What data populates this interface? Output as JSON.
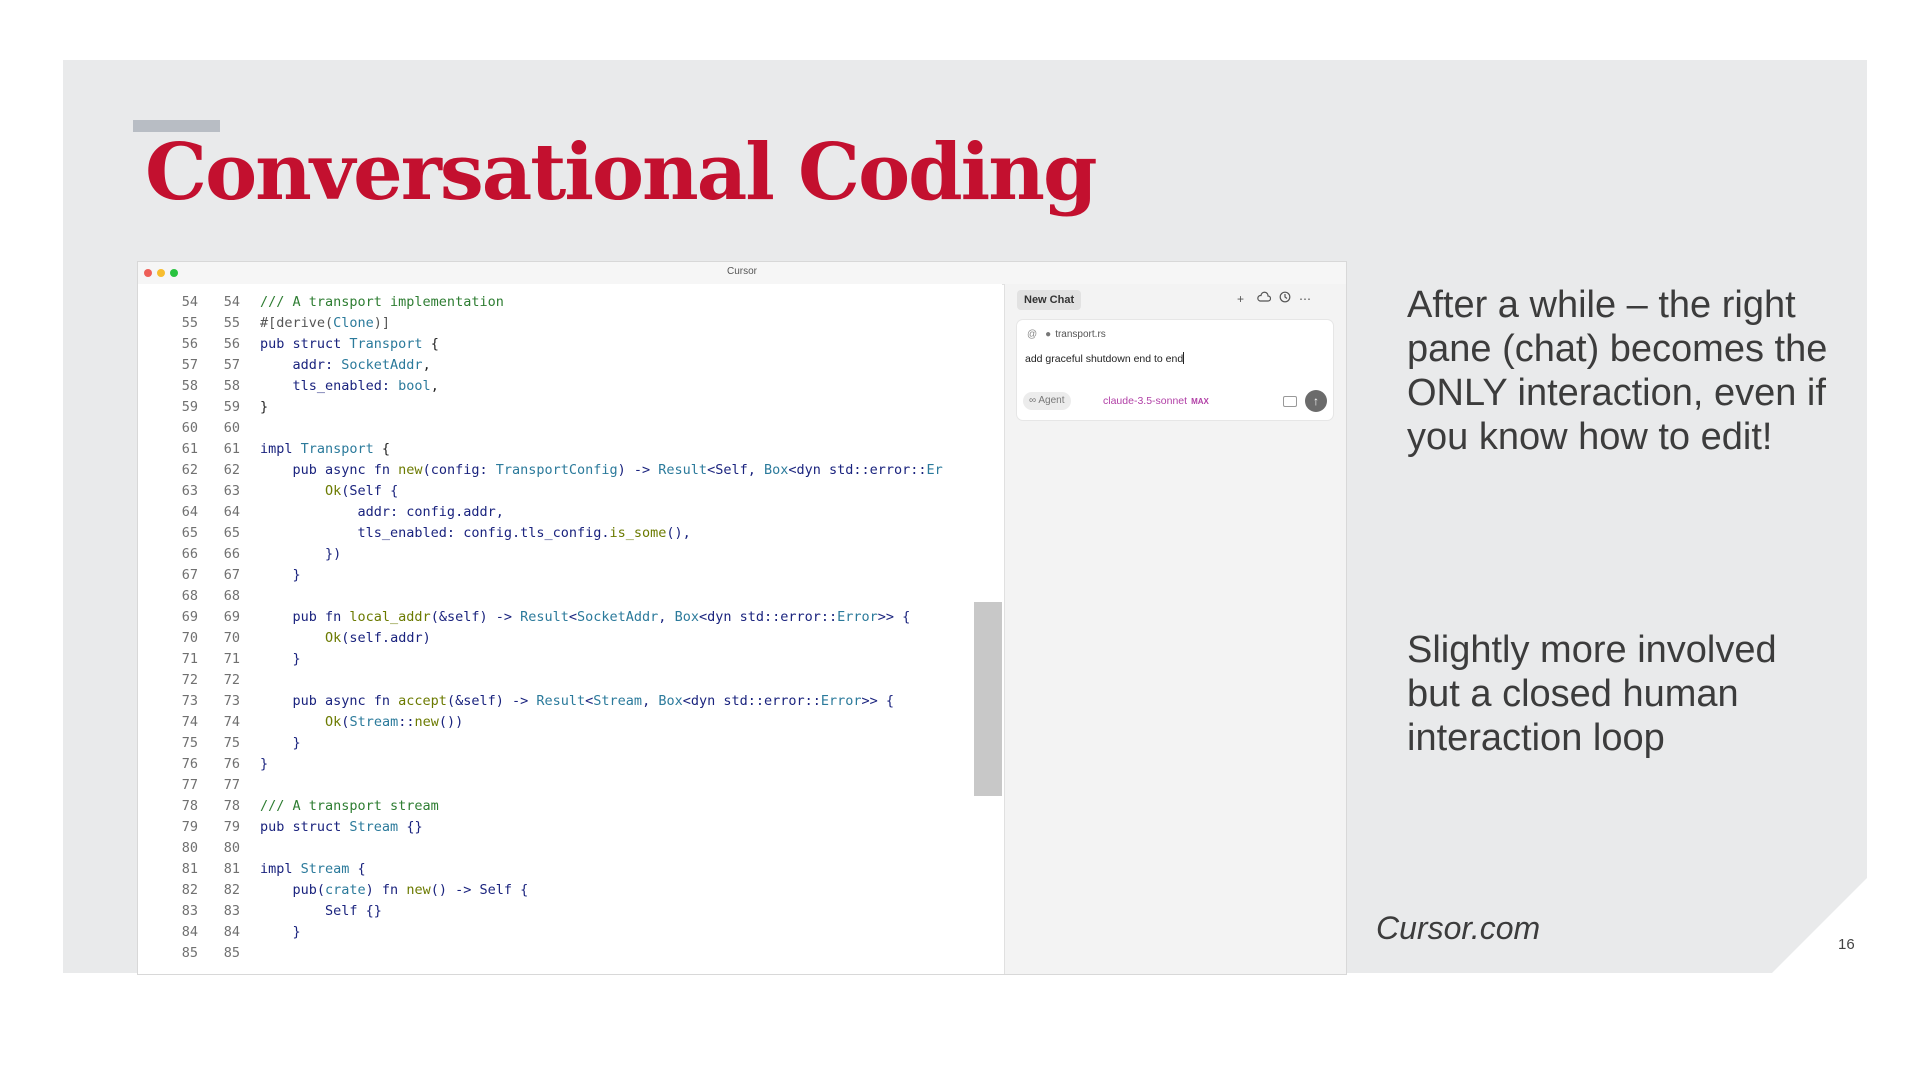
{
  "slide": {
    "title": "Conversational Coding",
    "paragraphs": [
      "After a while – the right pane (chat) becomes the ONLY interaction, even if you know how to edit!",
      "Slightly more involved but a closed human interaction loop"
    ],
    "source": "Cursor.com",
    "page_number": "16"
  },
  "window": {
    "title": "Cursor"
  },
  "editor": {
    "lines": [
      {
        "n1": "54",
        "n2": "54",
        "tokens": [
          [
            "c",
            "/// A transport implementation"
          ]
        ]
      },
      {
        "n1": "55",
        "n2": "55",
        "tokens": [
          [
            "a",
            "#[derive("
          ],
          [
            "ty",
            "Clone"
          ],
          [
            "a",
            ")]"
          ]
        ]
      },
      {
        "n1": "56",
        "n2": "56",
        "tokens": [
          [
            "k",
            "pub struct "
          ],
          [
            "ty",
            "Transport"
          ],
          [
            "p",
            " {"
          ]
        ]
      },
      {
        "n1": "57",
        "n2": "57",
        "tokens": [
          [
            "k",
            "    addr: "
          ],
          [
            "ty",
            "SocketAddr"
          ],
          [
            "p",
            ","
          ]
        ]
      },
      {
        "n1": "58",
        "n2": "58",
        "tokens": [
          [
            "k",
            "    tls_enabled: "
          ],
          [
            "ty",
            "bool"
          ],
          [
            "p",
            ","
          ]
        ]
      },
      {
        "n1": "59",
        "n2": "59",
        "tokens": [
          [
            "p",
            "}"
          ]
        ]
      },
      {
        "n1": "60",
        "n2": "60",
        "tokens": []
      },
      {
        "n1": "61",
        "n2": "61",
        "tokens": [
          [
            "k",
            "impl "
          ],
          [
            "ty",
            "Transport"
          ],
          [
            "p",
            " {"
          ]
        ]
      },
      {
        "n1": "62",
        "n2": "62",
        "tokens": [
          [
            "k",
            "    pub async fn "
          ],
          [
            "f",
            "new"
          ],
          [
            "k",
            "(config: "
          ],
          [
            "ty",
            "TransportConfig"
          ],
          [
            "k",
            ") -> "
          ],
          [
            "ty",
            "Result"
          ],
          [
            "k",
            "<Self, "
          ],
          [
            "ty",
            "Box"
          ],
          [
            "k",
            "<dyn std::error::"
          ],
          [
            "ty",
            "Er"
          ]
        ]
      },
      {
        "n1": "63",
        "n2": "63",
        "tokens": [
          [
            "k",
            "        "
          ],
          [
            "f",
            "Ok"
          ],
          [
            "k",
            "(Self {"
          ]
        ]
      },
      {
        "n1": "64",
        "n2": "64",
        "tokens": [
          [
            "k",
            "            addr: config.addr,"
          ]
        ]
      },
      {
        "n1": "65",
        "n2": "65",
        "tokens": [
          [
            "k",
            "            tls_enabled: config.tls_config."
          ],
          [
            "f",
            "is_some"
          ],
          [
            "k",
            "(),"
          ]
        ]
      },
      {
        "n1": "66",
        "n2": "66",
        "tokens": [
          [
            "k",
            "        })"
          ]
        ]
      },
      {
        "n1": "67",
        "n2": "67",
        "tokens": [
          [
            "k",
            "    }"
          ]
        ]
      },
      {
        "n1": "68",
        "n2": "68",
        "tokens": []
      },
      {
        "n1": "69",
        "n2": "69",
        "tokens": [
          [
            "k",
            "    pub fn "
          ],
          [
            "f",
            "local_addr"
          ],
          [
            "k",
            "(&self) -> "
          ],
          [
            "ty",
            "Result"
          ],
          [
            "k",
            "<"
          ],
          [
            "ty",
            "SocketAddr"
          ],
          [
            "k",
            ", "
          ],
          [
            "ty",
            "Box"
          ],
          [
            "k",
            "<dyn std::error::"
          ],
          [
            "ty",
            "Error"
          ],
          [
            "k",
            ">> {"
          ]
        ]
      },
      {
        "n1": "70",
        "n2": "70",
        "tokens": [
          [
            "k",
            "        "
          ],
          [
            "f",
            "Ok"
          ],
          [
            "k",
            "(self.addr)"
          ]
        ]
      },
      {
        "n1": "71",
        "n2": "71",
        "tokens": [
          [
            "k",
            "    }"
          ]
        ]
      },
      {
        "n1": "72",
        "n2": "72",
        "tokens": []
      },
      {
        "n1": "73",
        "n2": "73",
        "tokens": [
          [
            "k",
            "    pub async fn "
          ],
          [
            "f",
            "accept"
          ],
          [
            "k",
            "(&self) -> "
          ],
          [
            "ty",
            "Result"
          ],
          [
            "k",
            "<"
          ],
          [
            "ty",
            "Stream"
          ],
          [
            "k",
            ", "
          ],
          [
            "ty",
            "Box"
          ],
          [
            "k",
            "<dyn std::error::"
          ],
          [
            "ty",
            "Error"
          ],
          [
            "k",
            ">> {"
          ]
        ]
      },
      {
        "n1": "74",
        "n2": "74",
        "tokens": [
          [
            "k",
            "        "
          ],
          [
            "f",
            "Ok"
          ],
          [
            "k",
            "("
          ],
          [
            "ty",
            "Stream"
          ],
          [
            "k",
            "::"
          ],
          [
            "f",
            "new"
          ],
          [
            "k",
            "())"
          ]
        ]
      },
      {
        "n1": "75",
        "n2": "75",
        "tokens": [
          [
            "k",
            "    }"
          ]
        ]
      },
      {
        "n1": "76",
        "n2": "76",
        "tokens": [
          [
            "k",
            "}"
          ]
        ]
      },
      {
        "n1": "77",
        "n2": "77",
        "tokens": []
      },
      {
        "n1": "78",
        "n2": "78",
        "tokens": [
          [
            "c",
            "/// A transport stream"
          ]
        ]
      },
      {
        "n1": "79",
        "n2": "79",
        "tokens": [
          [
            "k",
            "pub struct "
          ],
          [
            "ty",
            "Stream"
          ],
          [
            "k",
            " {}"
          ]
        ]
      },
      {
        "n1": "80",
        "n2": "80",
        "tokens": []
      },
      {
        "n1": "81",
        "n2": "81",
        "tokens": [
          [
            "k",
            "impl "
          ],
          [
            "ty",
            "Stream"
          ],
          [
            "k",
            " {"
          ]
        ]
      },
      {
        "n1": "82",
        "n2": "82",
        "tokens": [
          [
            "k",
            "    pub("
          ],
          [
            "ty",
            "crate"
          ],
          [
            "k",
            ") fn "
          ],
          [
            "f",
            "new"
          ],
          [
            "k",
            "() -> Self {"
          ]
        ]
      },
      {
        "n1": "83",
        "n2": "83",
        "tokens": [
          [
            "k",
            "        Self {}"
          ]
        ]
      },
      {
        "n1": "84",
        "n2": "84",
        "tokens": [
          [
            "k",
            "    }"
          ]
        ]
      },
      {
        "n1": "85",
        "n2": "85",
        "tokens": []
      }
    ]
  },
  "chat": {
    "tab_label": "New Chat",
    "toolbar_icons": [
      "plus-icon",
      "cloud-icon",
      "history-icon",
      "more-icon"
    ],
    "context_at": "@",
    "context_file": "transport.rs",
    "prompt": "add graceful shutdown end to end",
    "mode": "∞ Agent",
    "model": "claude-3.5-sonnet",
    "model_badge": "MAX",
    "send_icon": "↑"
  },
  "colors": {
    "title": "#c3102f",
    "slide_bg": "#e9eaeb",
    "comment": "#2e7d32",
    "keyword": "#1a237e",
    "type": "#2b7a9b",
    "function": "#6b7a00",
    "model": "#b13fa6"
  }
}
